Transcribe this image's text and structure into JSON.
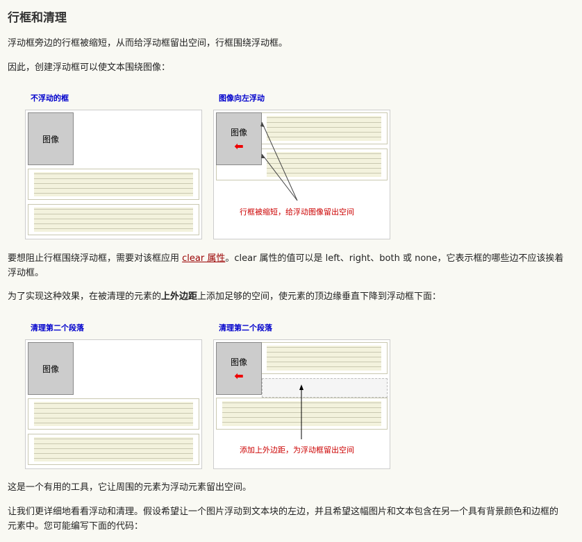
{
  "heading": "行框和清理",
  "p1": "浮动框旁边的行框被缩短，从而给浮动框留出空间，行框围绕浮动框。",
  "p2": "因此，创建浮动框可以使文本围绕图像：",
  "fig1": {
    "left_title": "不浮动的框",
    "right_title": "图像向左浮动",
    "image_label": "图像",
    "caption": "行框被缩短，给浮动图像留出空间"
  },
  "p3": {
    "before": "要想阻止行框围绕浮动框，需要对该框应用 ",
    "link": "clear 属性",
    "after": "。clear 属性的值可以是 left、right、both 或 none，它表示框的哪些边不应该挨着浮动框。"
  },
  "p4": {
    "before": "为了实现这种效果，在被清理的元素的",
    "bold": "上外边距",
    "after": "上添加足够的空间，使元素的顶边缘垂直下降到浮动框下面："
  },
  "fig2": {
    "left_title": "清理第二个段落",
    "right_title": "清理第二个段落",
    "image_label": "图像",
    "caption": "添加上外边距，为浮动框留出空间"
  },
  "p5": "这是一个有用的工具，它让周围的元素为浮动元素留出空间。",
  "p6": "让我们更详细地看看浮动和清理。假设希望让一个图片浮动到文本块的左边，并且希望这幅图片和文本包含在另一个具有背景颜色和边框的元素中。您可能编写下面的代码：",
  "colors": {
    "link": "#990000",
    "title": "#0000cc",
    "caption": "#cc0000",
    "arrow": "#ee0000"
  },
  "icons": {
    "float_arrow": "left-arrow-icon"
  }
}
